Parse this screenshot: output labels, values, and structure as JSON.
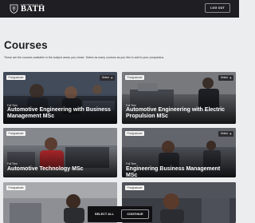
{
  "header": {
    "logo_small": "UNIVERSITY OF",
    "logo_big": "BATH",
    "logout_label": "LOG OUT"
  },
  "main": {
    "title": "Courses",
    "intro": "These are the courses available in the subject areas you chose. Select as many courses as you like to add to your prospectus."
  },
  "cards": [
    {
      "tag": "Postgraduate",
      "select_label": "Select",
      "mode": "Full Time",
      "title": "Automotive Engineering with Business Management MSc"
    },
    {
      "tag": "Postgraduate",
      "select_label": "Select",
      "mode": "Full Time",
      "title": "Automotive Engineering with Electric Propulsion MSc"
    },
    {
      "tag": "Postgraduate",
      "select_label": "",
      "mode": "Full Time",
      "title": "Automotive Technology MSc"
    },
    {
      "tag": "Postgraduate",
      "select_label": "Select",
      "mode": "Full Time",
      "title": "Engineering Business Management MSc"
    },
    {
      "tag": "Postgraduate",
      "select_label": "",
      "mode": "",
      "title": ""
    },
    {
      "tag": "Postgraduate",
      "select_label": "",
      "mode": "",
      "title": ""
    }
  ],
  "actions": {
    "select_all_label": "SELECT ALL",
    "continue_label": "CONTINUE"
  },
  "colors": {
    "header_bg": "#1f1f23",
    "page_bg": "#ecedef",
    "action_bar_bg": "#111114"
  },
  "icons": [
    "university-crest-icon",
    "plus-icon"
  ]
}
